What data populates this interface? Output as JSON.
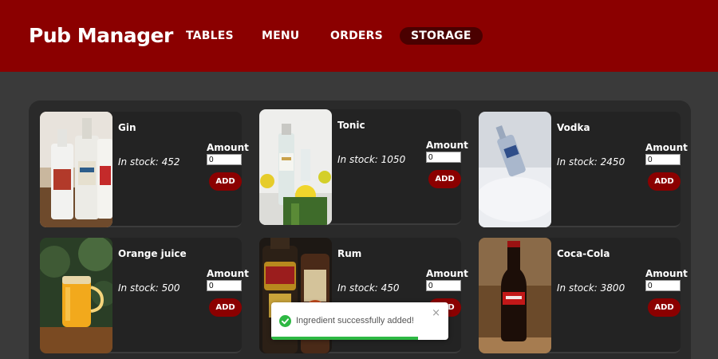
{
  "app": {
    "title": "Pub Manager"
  },
  "nav": [
    {
      "label": "TABLES"
    },
    {
      "label": "MENU"
    },
    {
      "label": "ORDERS"
    },
    {
      "label": "STORAGE",
      "active": true
    }
  ],
  "items": [
    {
      "name": "Gin",
      "stock": "In stock: 452",
      "amount_label": "Amount",
      "amount_value": "0",
      "add_label": "ADD"
    },
    {
      "name": "Tonic",
      "stock": "In stock: 1050",
      "amount_label": "Amount",
      "amount_value": "0",
      "add_label": "ADD"
    },
    {
      "name": "Vodka",
      "stock": "In stock: 2450",
      "amount_label": "Amount",
      "amount_value": "0",
      "add_label": "ADD"
    },
    {
      "name": "Orange juice",
      "stock": "In stock: 500",
      "amount_label": "Amount",
      "amount_value": "0",
      "add_label": "ADD"
    },
    {
      "name": "Rum",
      "stock": "In stock: 450",
      "amount_label": "Amount",
      "amount_value": "0",
      "add_label": "ADD"
    },
    {
      "name": "Coca-Cola",
      "stock": "In stock: 3800",
      "amount_label": "Amount",
      "amount_value": "0",
      "add_label": "ADD"
    }
  ],
  "toast": {
    "message": "Ingredient successfully added!",
    "close_symbol": "×",
    "progress": 0.83
  },
  "colors": {
    "header": "#8b0000",
    "accent": "#8b0000",
    "success": "#2db843",
    "background": "#3a3a3a",
    "panel": "#2a2a2a"
  }
}
